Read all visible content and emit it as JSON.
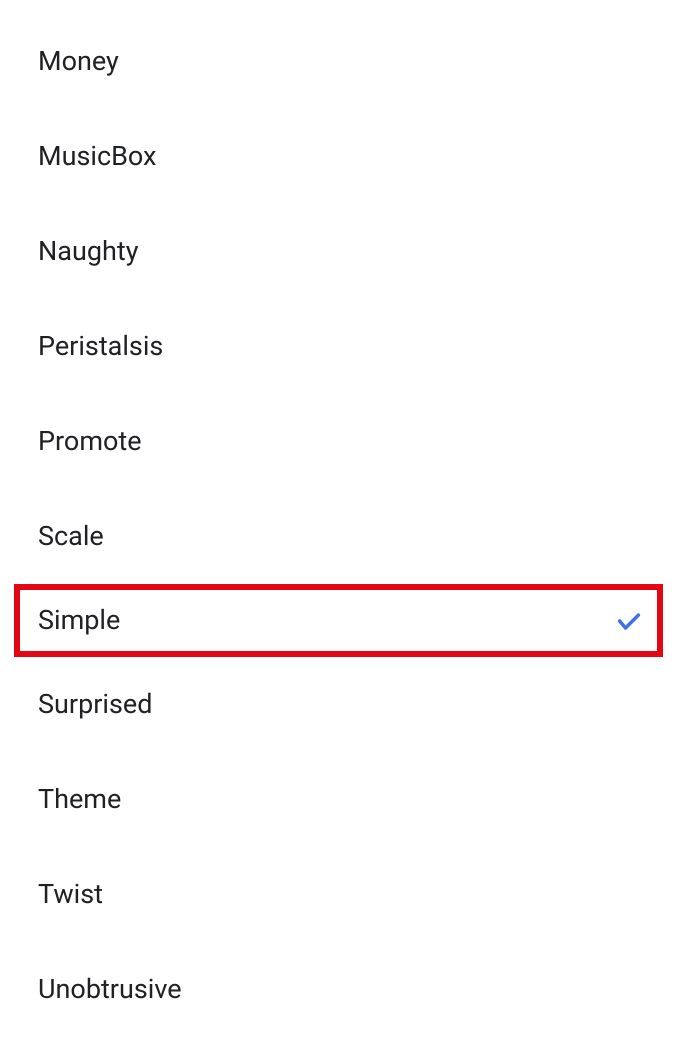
{
  "list": {
    "items": [
      {
        "label": "Money",
        "selected": false
      },
      {
        "label": "MusicBox",
        "selected": false
      },
      {
        "label": "Naughty",
        "selected": false
      },
      {
        "label": "Peristalsis",
        "selected": false
      },
      {
        "label": "Promote",
        "selected": false
      },
      {
        "label": "Scale",
        "selected": false
      },
      {
        "label": "Simple",
        "selected": true
      },
      {
        "label": "Surprised",
        "selected": false
      },
      {
        "label": "Theme",
        "selected": false
      },
      {
        "label": "Twist",
        "selected": false
      },
      {
        "label": "Unobtrusive",
        "selected": false
      }
    ]
  },
  "highlighted_index": 6,
  "colors": {
    "highlight_border": "#e30613",
    "check": "#4070e8",
    "text": "#202124"
  }
}
